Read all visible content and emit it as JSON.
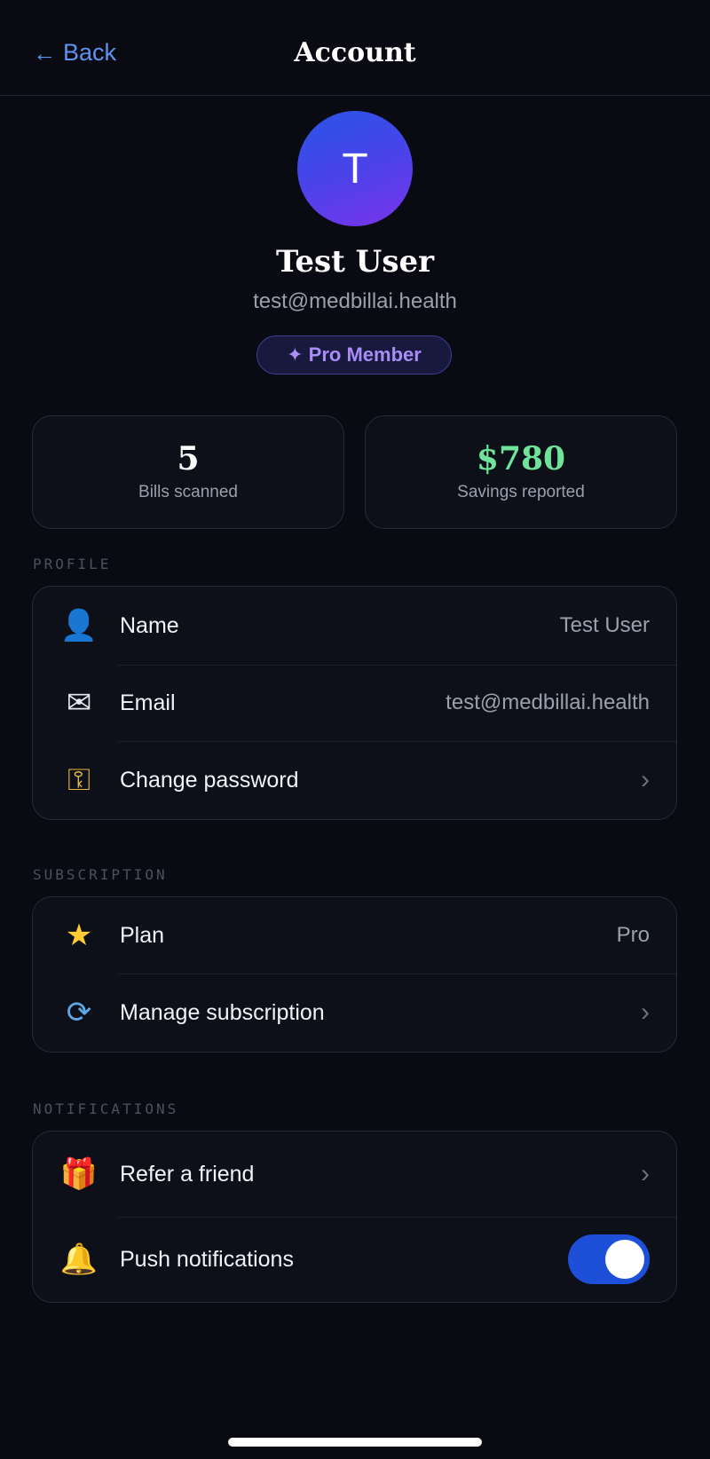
{
  "header": {
    "back_label": "Back",
    "title": "Account"
  },
  "profile": {
    "avatar_initial": "T",
    "name": "Test User",
    "email": "test@medbillai.health",
    "badge": "✦ Pro Member"
  },
  "stats": [
    {
      "value": "5",
      "label": "Bills scanned"
    },
    {
      "value": "$780",
      "label": "Savings reported"
    }
  ],
  "sections": {
    "profile": {
      "label": "PROFILE",
      "rows": {
        "name": {
          "icon": "person-icon",
          "label": "Name",
          "value": "Test User"
        },
        "email": {
          "icon": "envelope-icon",
          "label": "Email",
          "value": "test@medbillai.health"
        },
        "password": {
          "icon": "key-icon",
          "label": "Change password"
        }
      }
    },
    "subscription": {
      "label": "SUBSCRIPTION",
      "rows": {
        "plan": {
          "icon": "star-icon",
          "label": "Plan",
          "value": "Pro"
        },
        "manage": {
          "icon": "refresh-icon",
          "label": "Manage subscription"
        }
      }
    },
    "notifications": {
      "label": "NOTIFICATIONS",
      "rows": {
        "refer": {
          "icon": "gift-icon",
          "label": "Refer a friend"
        },
        "push": {
          "icon": "bell-icon",
          "label": "Push notifications",
          "enabled": true
        }
      }
    }
  },
  "colors": {
    "background": "#090a12",
    "accent_blue": "#5f93f0",
    "toggle_on": "#1d4fd9",
    "savings_green": "#6fe39a",
    "badge_purple": "#a98cf6"
  }
}
